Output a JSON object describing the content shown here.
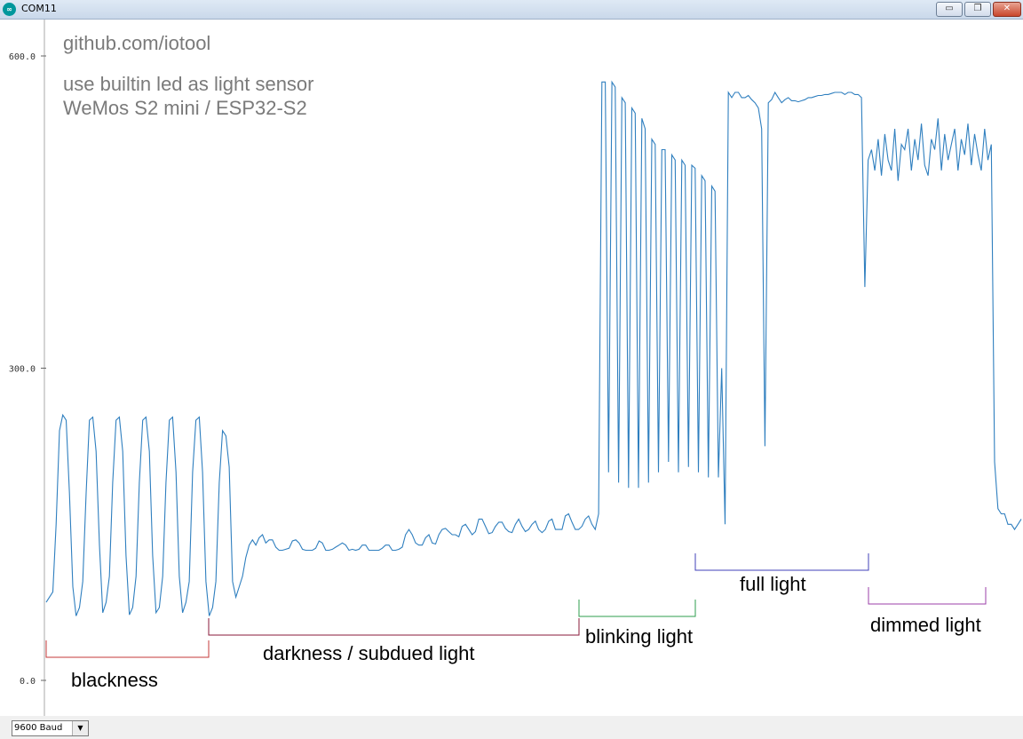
{
  "window": {
    "title": "COM11",
    "app_icon": "arduino-logo-icon",
    "minimize_glyph": "▭",
    "maximize_glyph": "❐",
    "close_glyph": "✕"
  },
  "watermark": {
    "line1": "github.com/iotool",
    "line2": "use builtin led as light sensor",
    "line3": "WeMos S2 mini / ESP32-S2"
  },
  "bottom_bar": {
    "baud_select": "9600 Baud",
    "dropdown_icon": "chevron-down-icon"
  },
  "colors": {
    "series": "#2f7fbf",
    "blackness": "#c43a3a",
    "darkness": "#8a1a3a",
    "blinking": "#2e9e4e",
    "full": "#4040b8",
    "dimmed": "#9b3fa8"
  },
  "chart_data": {
    "type": "line",
    "title": "",
    "xlabel": "",
    "ylabel": "",
    "ylim": [
      0,
      600
    ],
    "yticks": [
      "600.0",
      "300.0",
      "0.0"
    ],
    "grid": false,
    "series": [
      {
        "values": [
          75,
          80,
          85,
          150,
          240,
          255,
          250,
          180,
          90,
          62,
          70,
          95,
          180,
          250,
          253,
          220,
          130,
          65,
          75,
          100,
          190,
          250,
          253,
          220,
          120,
          63,
          70,
          100,
          190,
          250,
          253,
          220,
          120,
          65,
          70,
          100,
          190,
          250,
          253,
          200,
          100,
          65,
          75,
          95,
          200,
          250,
          253,
          200,
          95,
          62,
          70,
          95,
          190,
          240,
          235,
          205,
          95,
          80,
          90,
          100,
          118,
          130,
          135,
          130,
          137,
          140,
          132,
          135,
          135,
          128,
          125,
          125,
          126,
          127,
          134,
          135,
          132,
          126,
          125,
          125,
          125,
          127,
          134,
          132,
          125,
          125,
          126,
          128,
          130,
          132,
          130,
          125,
          126,
          125,
          126,
          130,
          130,
          125,
          125,
          125,
          125,
          127,
          130,
          130,
          125,
          125,
          126,
          128,
          140,
          145,
          140,
          132,
          130,
          130,
          137,
          140,
          132,
          131,
          140,
          145,
          146,
          143,
          140,
          140,
          138,
          148,
          150,
          145,
          140,
          143,
          155,
          155,
          148,
          141,
          142,
          148,
          152,
          152,
          146,
          143,
          142,
          150,
          155,
          148,
          143,
          145,
          150,
          153,
          145,
          142,
          145,
          153,
          155,
          145,
          145,
          145,
          158,
          160,
          152,
          145,
          145,
          148,
          155,
          158,
          150,
          145,
          160,
          575,
          575,
          200,
          575,
          570,
          190,
          560,
          555,
          185,
          550,
          545,
          185,
          540,
          530,
          190,
          520,
          515,
          200,
          510,
          510,
          210,
          505,
          500,
          200,
          500,
          495,
          205,
          495,
          492,
          200,
          485,
          480,
          195,
          475,
          470,
          195,
          300,
          150,
          565,
          560,
          565,
          565,
          560,
          560,
          562,
          558,
          555,
          550,
          530,
          225,
          555,
          558,
          565,
          560,
          555,
          558,
          560,
          557,
          557,
          556,
          557,
          558,
          560,
          560,
          561,
          562,
          562,
          563,
          563,
          564,
          565,
          565,
          565,
          563,
          565,
          565,
          563,
          563,
          560,
          378,
          500,
          510,
          490,
          520,
          485,
          525,
          500,
          490,
          530,
          480,
          515,
          510,
          530,
          490,
          520,
          500,
          535,
          495,
          485,
          520,
          510,
          540,
          490,
          525,
          500,
          515,
          530,
          490,
          520,
          505,
          535,
          495,
          525,
          505,
          490,
          530,
          500,
          515,
          210,
          165,
          160,
          160,
          150,
          150,
          145,
          150,
          155
        ]
      }
    ],
    "annotations": [
      {
        "text": "blackness",
        "color": "blackness"
      },
      {
        "text": "darkness / subdued light",
        "color": "darkness"
      },
      {
        "text": "blinking light",
        "color": "blinking"
      },
      {
        "text": "full light",
        "color": "full"
      },
      {
        "text": "dimmed light",
        "color": "dimmed"
      }
    ]
  }
}
